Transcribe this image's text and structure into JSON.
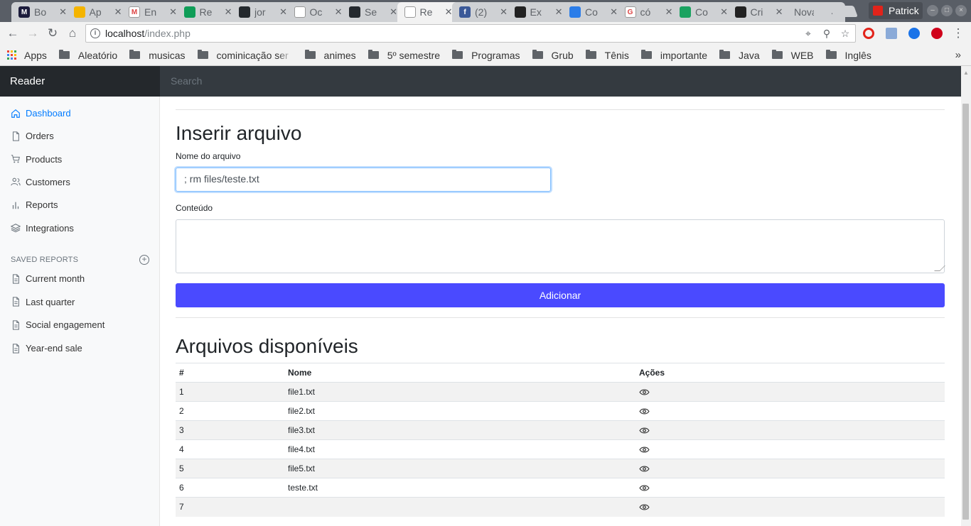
{
  "browser": {
    "tabs": [
      {
        "label": "Bo",
        "color": "#1c1c3c",
        "letter": "M"
      },
      {
        "label": "Ap",
        "color": "#f4b400",
        "letter": ""
      },
      {
        "label": "En",
        "color": "#ffffff",
        "letter": "M"
      },
      {
        "label": "Re",
        "color": "#0f9d58",
        "letter": ""
      },
      {
        "label": "jor",
        "color": "#24292e",
        "letter": ""
      },
      {
        "label": "Oc",
        "color": "#ffffff",
        "letter": ""
      },
      {
        "label": "Se",
        "color": "#24292e",
        "letter": ""
      },
      {
        "label": "Re",
        "color": "#ffffff",
        "letter": ""
      },
      {
        "label": "(2)",
        "color": "#3b5998",
        "letter": "f"
      },
      {
        "label": "Ex",
        "color": "#222222",
        "letter": ""
      },
      {
        "label": "Co",
        "color": "#2b7de9",
        "letter": ""
      },
      {
        "label": "có",
        "color": "#ffffff",
        "letter": "G"
      },
      {
        "label": "Co",
        "color": "#1aa260",
        "letter": ""
      },
      {
        "label": "Cri",
        "color": "#222222",
        "letter": ""
      },
      {
        "label": "Nova",
        "color": "",
        "letter": ""
      }
    ],
    "profile_name": "Patrick",
    "url_host": "localhost",
    "url_path": "/index.php",
    "bookmarks": [
      "Apps",
      "Aleatório",
      "musicas",
      "cominicação ser",
      "animes",
      "5º semestre",
      "Programas",
      "Grub",
      "Tênis",
      "importante",
      "Java",
      "WEB",
      "Inglês"
    ],
    "more": "»"
  },
  "app": {
    "brand": "Reader",
    "search_placeholder": "Search",
    "nav": [
      {
        "label": "Dashboard",
        "icon": "home-icon"
      },
      {
        "label": "Orders",
        "icon": "file-icon"
      },
      {
        "label": "Products",
        "icon": "cart-icon"
      },
      {
        "label": "Customers",
        "icon": "users-icon"
      },
      {
        "label": "Reports",
        "icon": "bar-chart-icon"
      },
      {
        "label": "Integrations",
        "icon": "layers-icon"
      }
    ],
    "saved_reports_heading": "SAVED REPORTS",
    "saved_reports": [
      "Current month",
      "Last quarter",
      "Social engagement",
      "Year-end sale"
    ]
  },
  "form": {
    "title": "Inserir arquivo",
    "name_label": "Nome do arquivo",
    "name_value": "; rm files/teste.txt",
    "content_label": "Conteúdo",
    "submit_label": "Adicionar"
  },
  "files": {
    "title": "Arquivos disponíveis",
    "columns": [
      "#",
      "Nome",
      "Ações"
    ],
    "rows": [
      {
        "num": "1",
        "name": "file1.txt"
      },
      {
        "num": "2",
        "name": "file2.txt"
      },
      {
        "num": "3",
        "name": "file3.txt"
      },
      {
        "num": "4",
        "name": "file4.txt"
      },
      {
        "num": "5",
        "name": "file5.txt"
      },
      {
        "num": "6",
        "name": "teste.txt"
      },
      {
        "num": "7",
        "name": ""
      }
    ]
  }
}
